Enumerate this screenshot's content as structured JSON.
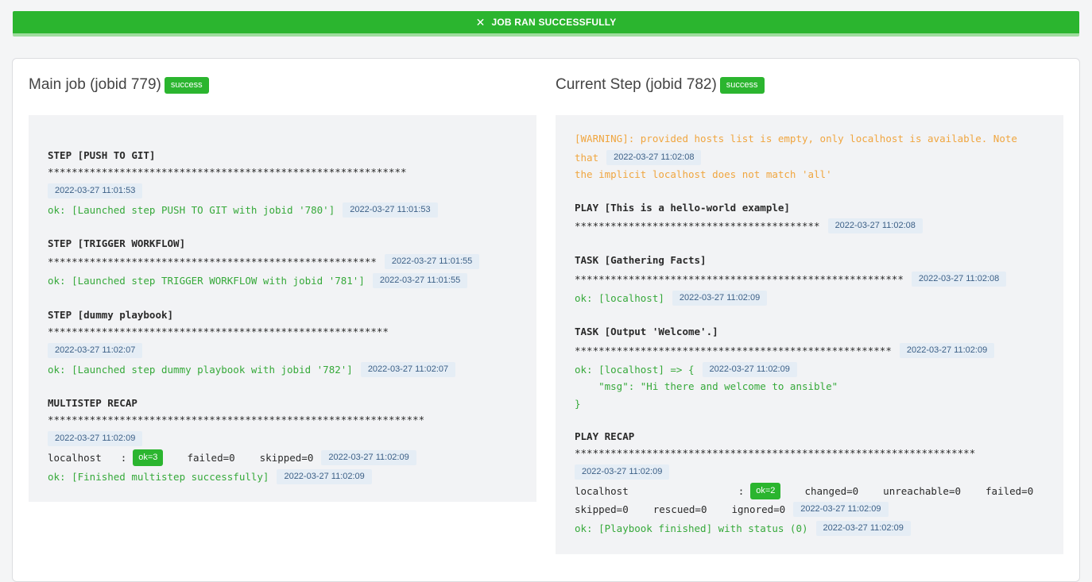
{
  "banner": {
    "close_glyph": "✕",
    "text": "JOB RAN SUCCESSFULLY",
    "color": "#2bb52f"
  },
  "main_job": {
    "title": "Main job (jobid 779)",
    "status": "success",
    "log": {
      "step1_title": "STEP [PUSH TO GIT]",
      "step1_stars": "************************************************************",
      "step1_ts": "2022-03-27 11:01:53",
      "step1_ok": "ok: [Launched step PUSH TO GIT with jobid '780']",
      "step1_ok_ts": "2022-03-27 11:01:53",
      "step2_title": "STEP [TRIGGER WORKFLOW]",
      "step2_stars": "*******************************************************",
      "step2_ts": "2022-03-27 11:01:55",
      "step2_ok": "ok: [Launched step TRIGGER WORKFLOW with jobid '781']",
      "step2_ok_ts": "2022-03-27 11:01:55",
      "step3_title": "STEP [dummy playbook]",
      "step3_stars": "*********************************************************",
      "step3_ts": "2022-03-27 11:02:07",
      "step3_ok": "ok: [Launched step dummy playbook with jobid '782']",
      "step3_ok_ts": "2022-03-27 11:02:07",
      "recap_title": "MULTISTEP RECAP",
      "recap_stars": "***************************************************************",
      "recap_ts": "2022-03-27 11:02:09",
      "host": "localhost",
      "colon": ":",
      "ok_count": "ok=3",
      "failed": "failed=0",
      "skipped": "skipped=0",
      "host_ts": "2022-03-27 11:02:09",
      "finish": "ok: [Finished multistep successfully]",
      "finish_ts": "2022-03-27 11:02:09"
    }
  },
  "current_step": {
    "title": "Current Step (jobid 782)",
    "status": "success",
    "log": {
      "warn1": "[WARNING]: provided hosts list is empty, only localhost is available. Note",
      "warn2": "that",
      "warn_ts": "2022-03-27 11:02:08",
      "warn3": "the implicit localhost does not match 'all'",
      "play_title": "PLAY [This is a hello-world example]",
      "play_stars": "*****************************************",
      "play_ts": "2022-03-27 11:02:08",
      "task1_title": "TASK [Gathering Facts]",
      "task1_stars": "*******************************************************",
      "task1_ts": "2022-03-27 11:02:08",
      "task1_ok": "ok: [localhost]",
      "task1_ok_ts": "2022-03-27 11:02:09",
      "task2_title": "TASK [Output 'Welcome'.]",
      "task2_stars": "*****************************************************",
      "task2_ts": "2022-03-27 11:02:09",
      "task2_ok": "ok: [localhost] => {",
      "task2_ok_ts": "2022-03-27 11:02:09",
      "msg": "    \"msg\": \"Hi there and welcome to ansible\"",
      "brace": "}",
      "recap_title": "PLAY RECAP",
      "recap_stars": "*******************************************************************",
      "recap_ts": "2022-03-27 11:02:09",
      "host": "localhost",
      "colon": ":",
      "ok_count": "ok=2",
      "changed": "changed=0",
      "unreachable": "unreachable=0",
      "failed": "failed=0",
      "skipped": "skipped=0",
      "rescued": "rescued=0",
      "ignored": "ignored=0",
      "stats_ts": "2022-03-27 11:02:09",
      "finish": "ok: [Playbook finished] with status (0)",
      "finish_ts": "2022-03-27 11:02:09"
    }
  }
}
